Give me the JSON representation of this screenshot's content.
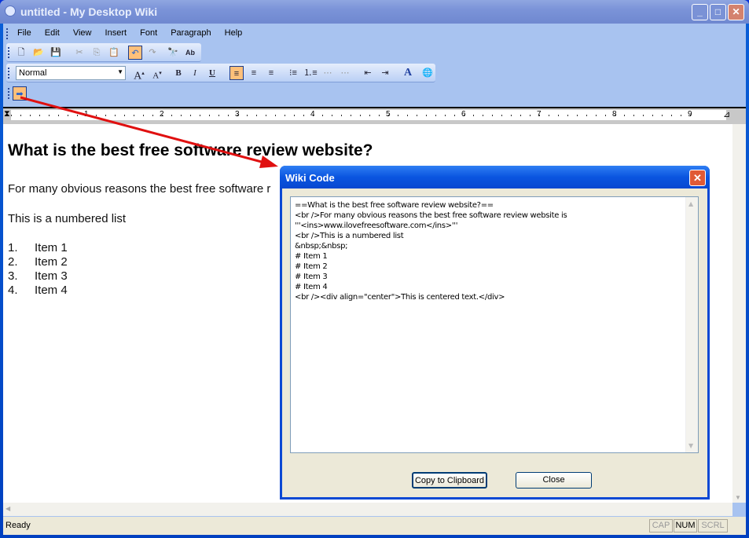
{
  "window": {
    "title": "untitled - My Desktop Wiki"
  },
  "menu": [
    "File",
    "Edit",
    "View",
    "Insert",
    "Font",
    "Paragraph",
    "Help"
  ],
  "toolbar": {
    "style_select": "Normal"
  },
  "ruler": [
    "1",
    "2",
    "3",
    "4",
    "5",
    "6",
    "7",
    "8",
    "9"
  ],
  "document": {
    "heading": "What is the best free software review website?",
    "paragraph": "For many obvious reasons the best free software r",
    "list_intro": "This is a numbered list",
    "items": [
      {
        "num": "1.",
        "text": "Item 1"
      },
      {
        "num": "2.",
        "text": "Item 2"
      },
      {
        "num": "3.",
        "text": "Item 3"
      },
      {
        "num": "4.",
        "text": "Item 4"
      }
    ]
  },
  "dialog": {
    "title": "Wiki Code",
    "code": "==What is the best free software review website?==\n<br />For many obvious reasons the best free software review website is\n'''<ins>www.ilovefreesoftware.com</ins>'''\n<br />This is a numbered list\n&nbsp;&nbsp;\n# Item 1\n# Item 2\n# Item 3\n# Item 4\n<br /><div align=\"center\">This is centered text.</div>",
    "copy_button": "Copy to Clipboard",
    "close_button": "Close"
  },
  "status": {
    "text": "Ready",
    "cap": "CAP",
    "num": "NUM",
    "scrl": "SCRL"
  },
  "colors": {
    "arrow": "#e01010",
    "highlight": "#ffc07a"
  }
}
